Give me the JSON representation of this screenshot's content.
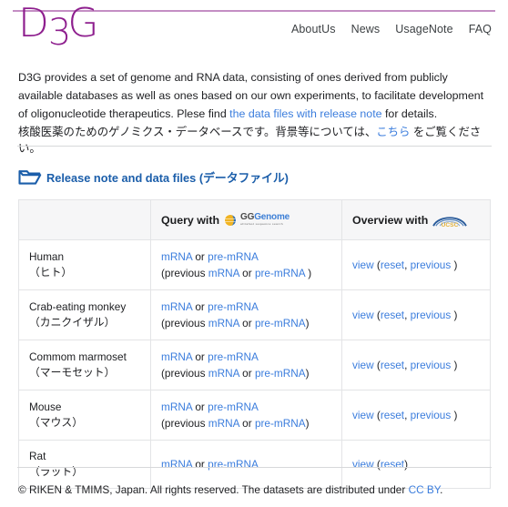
{
  "header": {
    "logo_text": "D3G",
    "logo_letters": {
      "d": "D",
      "three": "3",
      "g": "G"
    },
    "logo_color": "#8e1f8e",
    "nav": [
      {
        "label": "AboutUs"
      },
      {
        "label": "News"
      },
      {
        "label": "UsageNote"
      },
      {
        "label": "FAQ"
      }
    ]
  },
  "intro": {
    "line1": "D3G provides a set of genome and RNA data, consisting of ones derived from publicly available",
    "line2": "databases as well as ones based on our own experiments, to facilitate development of oligonucleotide",
    "line3_before": "therapeutics. Plese find ",
    "link_text": "the data files with release note",
    "line3_after": " for details.",
    "jp_before": "核酸医薬のためのゲノミクス・データベースです。背景等については、",
    "jp_link": "こちら",
    "jp_after": " をご覧ください。"
  },
  "section": {
    "title": "Release note and data files (データファイル)",
    "icon": "folder-open-icon",
    "color": "#1b5eaa"
  },
  "table": {
    "headers": {
      "species": "",
      "query_prefix": "Query with",
      "query_logo": "GGGenome",
      "query_logo_gg": "GG",
      "query_logo_genome": "Genome",
      "query_logo_tagline": "ultrafast sequence search",
      "overview_prefix": "Overview with",
      "overview_logo": "UCSC"
    },
    "rows": [
      {
        "species_en": "Human",
        "species_jp": "（ヒト）",
        "query_line1": {
          "link1": "mRNA",
          "sep": " or ",
          "link2": "pre-mRNA"
        },
        "query_line2": {
          "prefix": "(previous ",
          "link1": "mRNA",
          "sep": " or ",
          "link2": "pre-mRNA",
          "suffix": " )"
        },
        "overview": {
          "view": "view",
          "open": " (",
          "reset": "reset",
          "comma": ", ",
          "previous": "previous",
          "close": " )"
        }
      },
      {
        "species_en": "Crab-eating monkey",
        "species_jp": "（カニクイザル）",
        "query_line1": {
          "link1": "mRNA",
          "sep": " or ",
          "link2": "pre-mRNA"
        },
        "query_line2": {
          "prefix": "(previous ",
          "link1": "mRNA",
          "sep": " or ",
          "link2": "pre-mRNA",
          "suffix": ")"
        },
        "overview": {
          "view": "view",
          "open": " (",
          "reset": "reset",
          "comma": ", ",
          "previous": "previous",
          "close": " )"
        }
      },
      {
        "species_en": "Commom marmoset",
        "species_jp": "（マーモセット）",
        "query_line1": {
          "link1": "mRNA",
          "sep": " or ",
          "link2": "pre-mRNA"
        },
        "query_line2": {
          "prefix": "(previous ",
          "link1": "mRNA",
          "sep": " or ",
          "link2": "pre-mRNA",
          "suffix": ")"
        },
        "overview": {
          "view": "view",
          "open": " (",
          "reset": "reset",
          "comma": ", ",
          "previous": "previous",
          "close": " )"
        }
      },
      {
        "species_en": "Mouse",
        "species_jp": "（マウス）",
        "query_line1": {
          "link1": "mRNA",
          "sep": " or ",
          "link2": "pre-mRNA"
        },
        "query_line2": {
          "prefix": "(previous ",
          "link1": "mRNA",
          "sep": " or ",
          "link2": "pre-mRNA",
          "suffix": ")"
        },
        "overview": {
          "view": "view",
          "open": " (",
          "reset": "reset",
          "comma": ", ",
          "previous": "previous",
          "close": " )"
        }
      },
      {
        "species_en": "Rat",
        "species_jp": "（ラット）",
        "query_line1": {
          "link1": "mRNA",
          "sep": " or ",
          "link2": "pre-mRNA"
        },
        "query_line2": null,
        "overview": {
          "view": "view",
          "open": " (",
          "reset": "reset",
          "comma": null,
          "previous": null,
          "close": ")"
        }
      }
    ]
  },
  "footer": {
    "text_before": "© RIKEN & TMIMS, Japan. All rights reserved. The datasets are distributed under ",
    "link": "CC BY",
    "text_after": "."
  },
  "colors": {
    "link": "#3b7ddd",
    "brand_purple": "#8e1f8e",
    "section_blue": "#1b5eaa",
    "header_bg": "#f6f6f7",
    "border": "#e3e4e6",
    "rule": "#d7d8da"
  }
}
